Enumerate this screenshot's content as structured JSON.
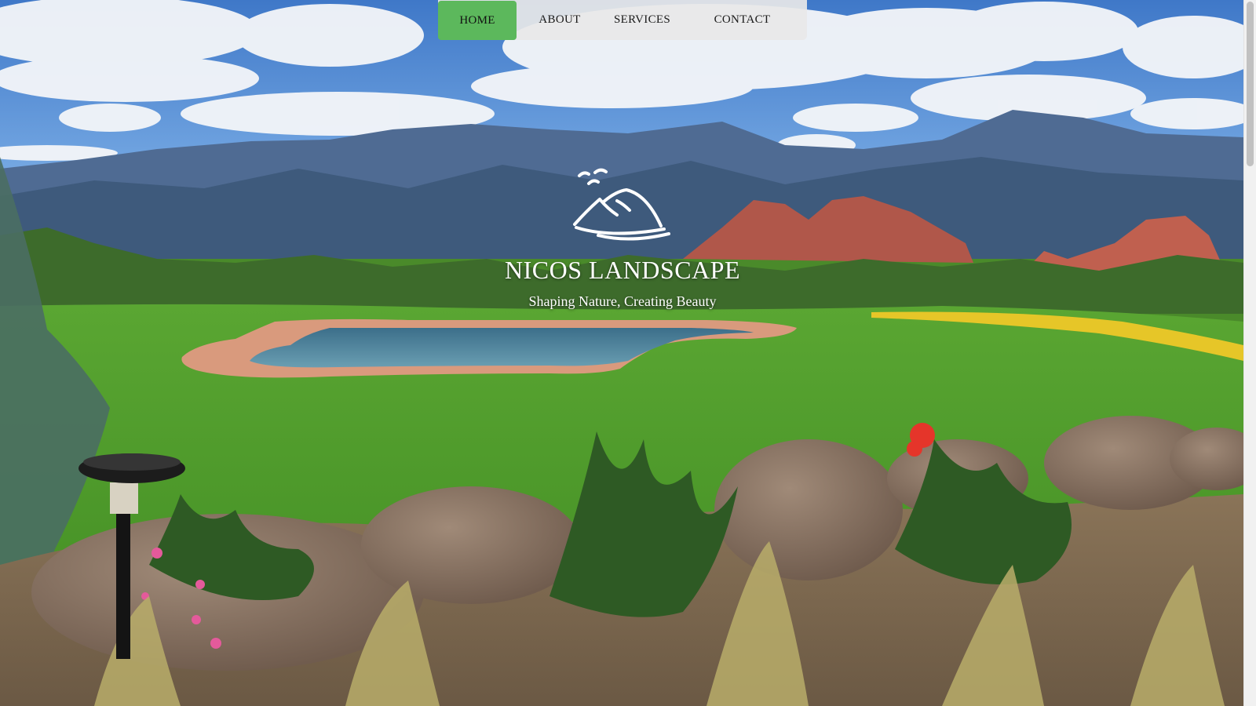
{
  "nav": {
    "items": [
      {
        "label": "HOME",
        "active": true
      },
      {
        "label": "ABOUT",
        "active": false
      },
      {
        "label": "SERVICES",
        "active": false
      },
      {
        "label": "CONTACT",
        "active": false
      }
    ],
    "active_color": "#5cb85c",
    "bar_color": "#e8e8e8"
  },
  "hero": {
    "logo_icon": "mountain-birds-logo-icon",
    "title": "NICOS LANDSCAPE",
    "tagline": "Shaping Nature, Creating Beauty",
    "background_image": "landscape-pool-mountains-photo"
  }
}
